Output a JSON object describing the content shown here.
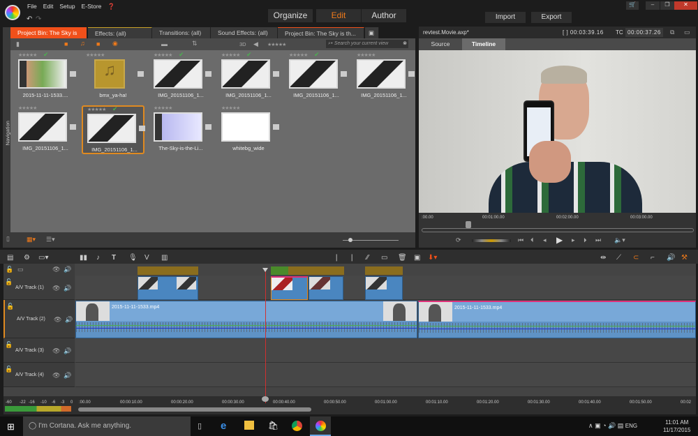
{
  "app": {
    "menu": [
      "File",
      "Edit",
      "Setup",
      "E-Store"
    ],
    "help_icon": "help-icon",
    "modes": [
      "Organize",
      "Edit",
      "Author"
    ],
    "active_mode": "Edit",
    "import": "Import",
    "export": "Export",
    "accent": "#f07a1a"
  },
  "library": {
    "tabs": [
      "Project Bin: The Sky is th...",
      "Effects: (all)",
      "Transitions: (all)",
      "Sound Effects: (all)",
      "Project Bin: The Sky is th..."
    ],
    "close": "×",
    "toolbar_3d": "3D",
    "search_placeholder": "Search your current view",
    "navigation": "Navigation",
    "items": [
      {
        "label": "2015-11-11-1533....",
        "checked": true,
        "kind": "video"
      },
      {
        "label": "bmx_ya-ha!",
        "checked": false,
        "kind": "audio"
      },
      {
        "label": "IMG_20151106_1...",
        "checked": true,
        "kind": "photo"
      },
      {
        "label": "IMG_20151106_1...",
        "checked": true,
        "kind": "photo"
      },
      {
        "label": "IMG_20151106_1...",
        "checked": true,
        "kind": "photo"
      },
      {
        "label": "IMG_20151106_1...",
        "checked": false,
        "kind": "photo"
      },
      {
        "label": "IMG_20151106_1...",
        "checked": false,
        "kind": "photo"
      },
      {
        "label": "IMG_20151106_1...",
        "checked": true,
        "kind": "photo",
        "selected": true
      },
      {
        "label": "The-Sky-is-the-Li...",
        "checked": false,
        "kind": "video"
      },
      {
        "label": "whitebg_wide",
        "checked": false,
        "kind": "photo"
      }
    ]
  },
  "player": {
    "project": "revtest.Movie.axp*",
    "duration": "[ ] 00:03:39.16",
    "tc_label": "TC",
    "tc": "00:00:37.26",
    "tabs": [
      "Source",
      "Timeline"
    ],
    "active_tab": "Timeline",
    "ruler": [
      ":00.00",
      "00:01:00.00",
      "00:02:00.00",
      "00:03:00.00"
    ]
  },
  "timeline": {
    "tracks": [
      "A/V Track (1)",
      "A/V Track (2)",
      "A/V Track (3)",
      "A/V Track (4)"
    ],
    "clip_name": "2015-11-11-1533.mp4",
    "meter": [
      "-60",
      "-22",
      "-16",
      "-10",
      "-6",
      "-3",
      "0"
    ],
    "ruler": [
      ":00.00",
      "00:00:10.00",
      "00:00:20.00",
      "00:00:30.00",
      "00:00:40.00",
      "00:00:50.00",
      "00:01:00.00",
      "00:01:10.00",
      "00:01:20.00",
      "00:01:30.00",
      "00:01:40.00",
      "00:01:50.00",
      "00:02"
    ],
    "playhead_seconds": 37.26
  },
  "taskbar": {
    "cortana": "I'm Cortana. Ask me anything.",
    "lang": "ENG",
    "time": "11:01 AM",
    "date": "11/17/2015"
  }
}
